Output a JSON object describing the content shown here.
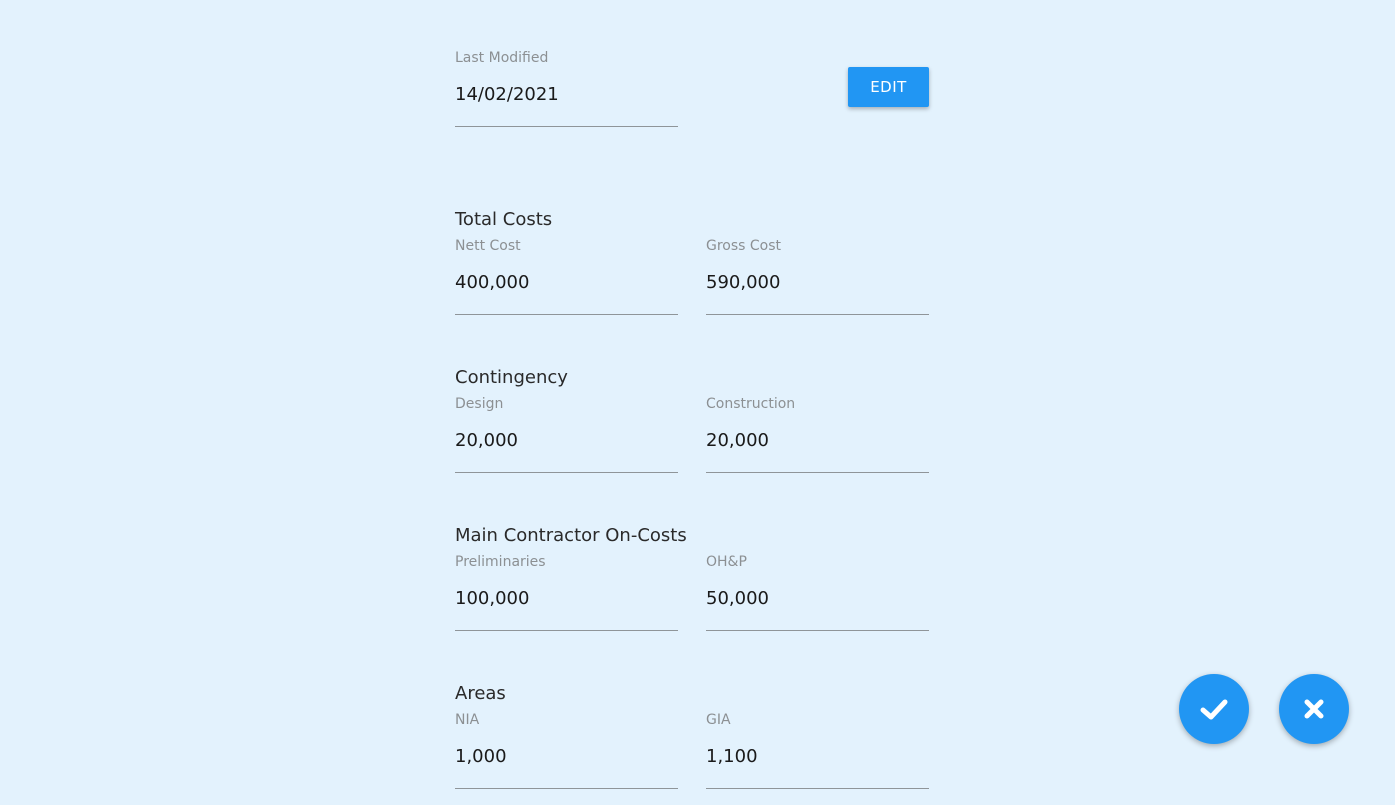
{
  "header": {
    "last_modified_label": "Last Modified",
    "last_modified_value": "14/02/2021",
    "edit_label": "EDIT"
  },
  "sections": {
    "total_costs": {
      "title": "Total Costs",
      "nett_label": "Nett Cost",
      "nett_value": "400,000",
      "gross_label": "Gross Cost",
      "gross_value": "590,000"
    },
    "contingency": {
      "title": "Contingency",
      "design_label": "Design",
      "design_value": "20,000",
      "construction_label": "Construction",
      "construction_value": "20,000"
    },
    "main_contractor": {
      "title": "Main Contractor On-Costs",
      "preliminaries_label": "Preliminaries",
      "preliminaries_value": "100,000",
      "ohp_label": "OH&P",
      "ohp_value": "50,000"
    },
    "areas": {
      "title": "Areas",
      "nia_label": "NIA",
      "nia_value": "1,000",
      "gia_label": "GIA",
      "gia_value": "1,100"
    }
  },
  "actions": {
    "confirm_icon": "check-icon",
    "cancel_icon": "close-icon"
  },
  "colors": {
    "background": "#e3f2fd",
    "accent": "#2196f3"
  }
}
